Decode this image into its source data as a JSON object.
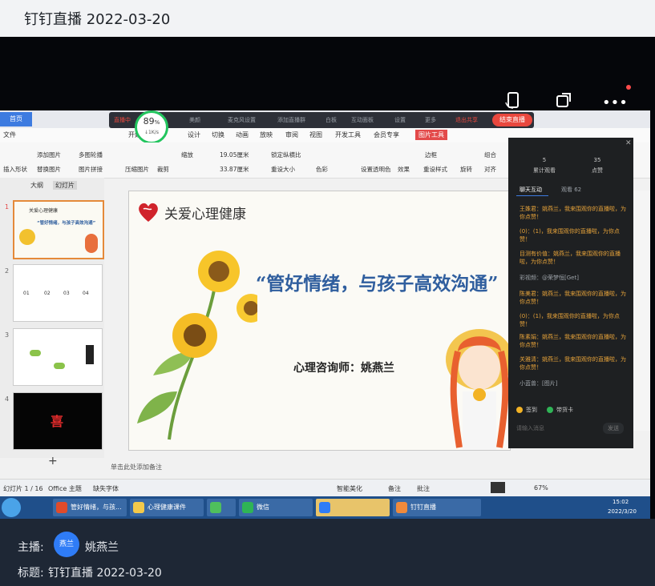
{
  "header": {
    "title": "钉钉直播 2022-03-20"
  },
  "stream": {
    "top_icons": [
      "rotate-screen-icon",
      "share-icon",
      "more-icon"
    ],
    "more_glyph": "•••",
    "wps": {
      "home_tab": "首页",
      "menu_tabs": [
        "文件",
        "开始",
        "插入",
        "设计",
        "切换",
        "动画",
        "放映",
        "审阅",
        "视图",
        "开发工具",
        "会员专享",
        "图片工具"
      ],
      "live_controls": [
        "直播中",
        "美颜",
        "麦克风设置",
        "添加直播群",
        "白板",
        "互动面板",
        "设置",
        "更多",
        "退出共享"
      ],
      "end_live": "结束直播",
      "network": {
        "percent": "89",
        "unit": "%",
        "speed": "↓1K/s"
      },
      "toolbar_items": [
        "插入形状",
        "替换图片",
        "添加图片",
        "图片拼接",
        "多图轮播",
        "压缩图片",
        "裁剪",
        "缩放",
        "19.05厘米",
        "33.87厘米",
        "锁定纵横比",
        "重设大小",
        "色彩",
        "设置透明色",
        "效果",
        "重设样式",
        "边框",
        "旋转",
        "对齐",
        "组合"
      ],
      "left_tabs": [
        "大纲",
        "幻灯片"
      ],
      "slide_numbers": [
        "1",
        "2",
        "3",
        "4"
      ],
      "thumb_texts": {
        "t1_title": "关爱心理健康",
        "t1_main": "“管好情绪，与孩子高效沟通”",
        "t2_nums": [
          "01",
          "02",
          "03",
          "04"
        ],
        "t4": "喜"
      },
      "add_slide": "+",
      "slide": {
        "title": "关爱心理健康",
        "main": "“管好情绪，与孩子高效沟通”",
        "sub": "心理咨询师：姚燕兰"
      },
      "notes": "单击此处添加备注",
      "status": {
        "slide_count": "幻灯片 1 / 16",
        "theme": "Office 主题",
        "font": "缺失字体",
        "beautify": "智能美化",
        "remark": "备注",
        "comment": "批注",
        "zoom": "67%"
      },
      "taskbar": {
        "items": [
          "管好情绪，与孩...",
          "心理健康课件",
          "",
          "微信",
          "",
          "钉钉直播"
        ],
        "time": "15:02",
        "date": "2022/3/20"
      }
    },
    "chat_panel": {
      "header_left": "累计观看",
      "header_right": "点赞",
      "header_left_num": "5",
      "header_right_num": "35",
      "tabs": [
        "聊天互动",
        "观看 62"
      ],
      "messages": [
        {
          "text": "王姝君：姚燕兰，我来围观你的直播啦，为你点赞！",
          "color": "orange"
        },
        {
          "text": "(0)：(1)，我来围观你的直播啦，为你点赞！",
          "color": "orange"
        },
        {
          "text": "目测有价值：姚燕兰，我来围观你的直播啦，为你点赞！",
          "color": "orange"
        },
        {
          "text": "彩视频：@荣梦恒[Get]",
          "color": "gray"
        },
        {
          "text": "陈美君：姚燕兰，我来围观你的直播啦，为你点赞！",
          "color": "orange"
        },
        {
          "text": "(0)：(1)，我来围观你的直播啦，为你点赞！",
          "color": "orange"
        },
        {
          "text": "陈素娟：姚燕兰，我来围观你的直播啦，为你点赞！",
          "color": "orange"
        },
        {
          "text": "关雅清：姚燕兰，我来围观你的直播啦，为你点赞！",
          "color": "orange"
        },
        {
          "text": "小蓝兽：[图片]",
          "color": "gray"
        }
      ],
      "bottom_btns": [
        "签到",
        "带货卡"
      ],
      "input_placeholder": "请输入消息",
      "send": "发送"
    }
  },
  "footer": {
    "host_label": "主播:",
    "avatar_text": "燕兰",
    "host_name": "姚燕兰",
    "title_label": "标题:",
    "title_value": "钉钉直播 2022-03-20"
  }
}
